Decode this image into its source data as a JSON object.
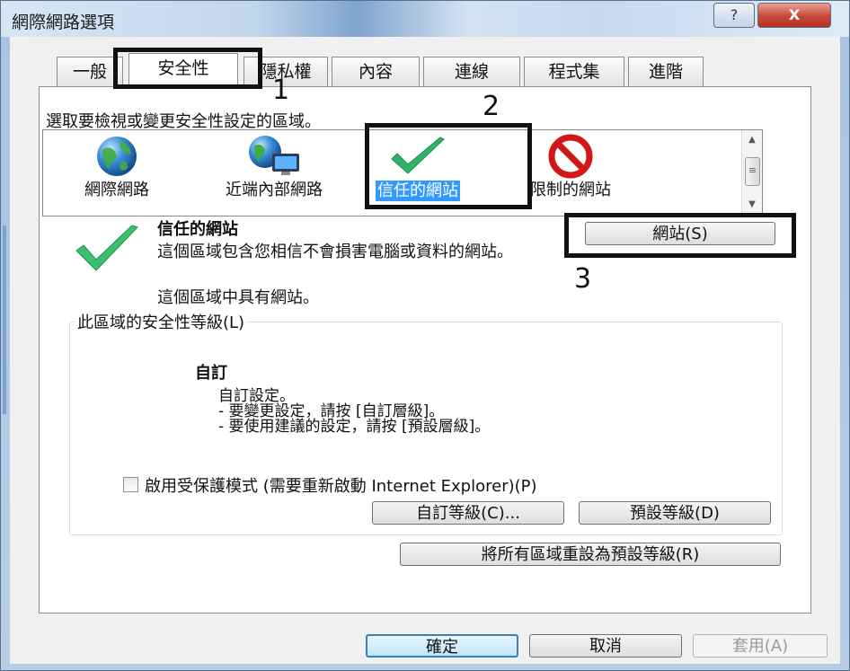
{
  "window": {
    "title": "網際網路選項",
    "help_label": "?",
    "close_label": "X"
  },
  "tabs": [
    "一般",
    "安全性",
    "隱私權",
    "內容",
    "連線",
    "程式集",
    "進階"
  ],
  "active_tab": "安全性",
  "zone_prompt": "選取要檢視或變更安全性設定的區域。",
  "zones": [
    {
      "label": "網際網路",
      "icon": "globe-icon"
    },
    {
      "label": "近端內部網路",
      "icon": "intranet-icon"
    },
    {
      "label": "信任的網站",
      "icon": "checkmark-icon",
      "selected": true
    },
    {
      "label": "限制的網站",
      "icon": "restricted-icon"
    }
  ],
  "selected_zone": {
    "title": "信任的網站",
    "description": "這個區域包含您相信不會損害電腦或資料的網站。",
    "has_sites": "這個區域中具有網站。",
    "sites_button": "網站(S)"
  },
  "security_level": {
    "group_label": "此區域的安全性等級(L)",
    "level_title": "自訂",
    "level_desc": "自訂設定。\n- 要變更設定，請按 [自訂層級]。\n- 要使用建議的設定，請按 [預設層級]。",
    "protected_mode_label": "啟用受保護模式 (需要重新啟動 Internet Explorer)(P)",
    "protected_mode_checked": false,
    "custom_level_button": "自訂等級(C)...",
    "default_level_button": "預設等級(D)"
  },
  "reset_all_button": "將所有區域重設為預設等級(R)",
  "footer": {
    "ok_label": "確定",
    "cancel_label": "取消",
    "apply_label": "套用(A)"
  },
  "annotations": [
    "1",
    "2",
    "3"
  ],
  "colors": {
    "selection": "#3399ff",
    "annotation": "#111111",
    "close_button": "#c7473a"
  }
}
